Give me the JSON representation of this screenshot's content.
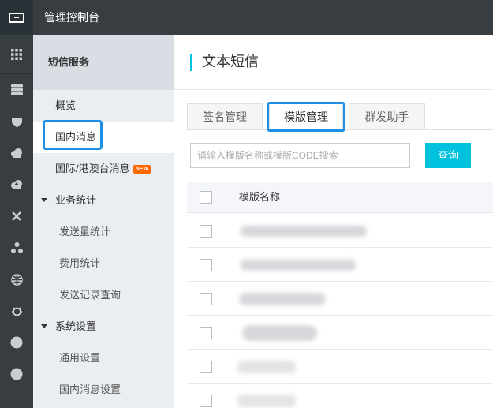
{
  "app": {
    "title": "管理控制台"
  },
  "rail": {
    "icons": [
      "grid-icon",
      "database-icon",
      "shield-icon",
      "cloud-icon",
      "cloud-upload-icon",
      "network-icon",
      "cluster-icon",
      "globe-icon",
      "bug-icon",
      "circle-icon",
      "circle-icon"
    ]
  },
  "sidebar": {
    "header": "短信服务",
    "items": [
      {
        "label": "概览"
      },
      {
        "label": "国内消息"
      },
      {
        "label": "国际/港澳台消息",
        "badge": "NEW"
      }
    ],
    "groups": [
      {
        "label": "业务统计",
        "children": [
          {
            "label": "发送量统计"
          },
          {
            "label": "费用统计"
          },
          {
            "label": "发送记录查询"
          }
        ]
      },
      {
        "label": "系统设置",
        "children": [
          {
            "label": "通用设置"
          },
          {
            "label": "国内消息设置"
          }
        ]
      }
    ]
  },
  "main": {
    "title": "文本短信",
    "tabs": [
      {
        "label": "签名管理"
      },
      {
        "label": "模版管理",
        "active": true
      },
      {
        "label": "群发助手"
      }
    ],
    "search": {
      "placeholder": "请输入模版名称或模版CODE搜索",
      "value": ""
    },
    "query_button": "查询",
    "table": {
      "columns": [
        "模版名称"
      ],
      "rows": [
        {},
        {},
        {},
        {},
        {},
        {}
      ]
    }
  },
  "colors": {
    "accent": "#00c1de",
    "topbar": "#373d41",
    "highlight": "#1f8fe6",
    "badge": "#ff6a00"
  }
}
